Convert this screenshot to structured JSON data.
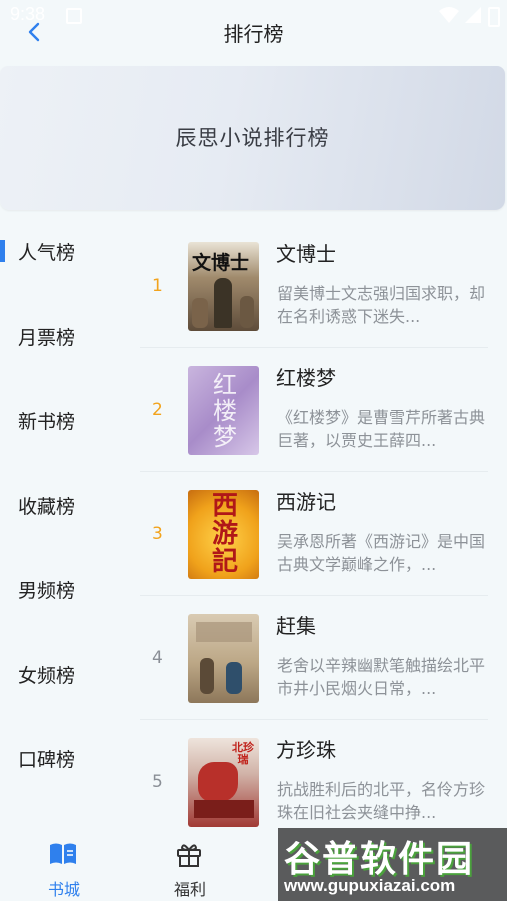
{
  "status_bar": {
    "time": "9:38"
  },
  "header": {
    "title": "排行榜"
  },
  "banner": {
    "title": "辰思小说排行榜"
  },
  "sidebar": {
    "items": [
      {
        "label": "人气榜",
        "active": true
      },
      {
        "label": "月票榜",
        "active": false
      },
      {
        "label": "新书榜",
        "active": false
      },
      {
        "label": "收藏榜",
        "active": false
      },
      {
        "label": "男频榜",
        "active": false
      },
      {
        "label": "女频榜",
        "active": false
      },
      {
        "label": "口碑榜",
        "active": false
      }
    ]
  },
  "books": [
    {
      "rank": "1",
      "title": "文博士",
      "description": "留美博士文志强归国求职，却在名利诱惑下迷失...",
      "cover_text": "文博士"
    },
    {
      "rank": "2",
      "title": "红楼梦",
      "description": "《红楼梦》是曹雪芹所著古典巨著，以贾史王薛四...",
      "cover_text": "红楼梦"
    },
    {
      "rank": "3",
      "title": "西游记",
      "description": "吴承恩所著《西游记》是中国古典文学巅峰之作，...",
      "cover_text": "西游記"
    },
    {
      "rank": "4",
      "title": "赶集",
      "description": "老舍以辛辣幽默笔触描绘北平市井小民烟火日常，...",
      "cover_text": ""
    },
    {
      "rank": "5",
      "title": "方珍珠",
      "description": "抗战胜利后的北平，名伶方珍珠在旧社会夹缝中挣...",
      "cover_text": "北珍瑞"
    }
  ],
  "bottom_nav": {
    "items": [
      {
        "label": "书城",
        "icon": "book-open-icon",
        "active": true
      },
      {
        "label": "福利",
        "icon": "gift-icon",
        "active": false
      }
    ]
  },
  "watermark": {
    "text": "谷普软件园",
    "url": "www.gupuxiazai.com"
  },
  "colors": {
    "accent": "#2f80ed",
    "rank_top": "#f2a31c",
    "rank_other": "#8a8f96",
    "background": "#f3f8fa"
  }
}
